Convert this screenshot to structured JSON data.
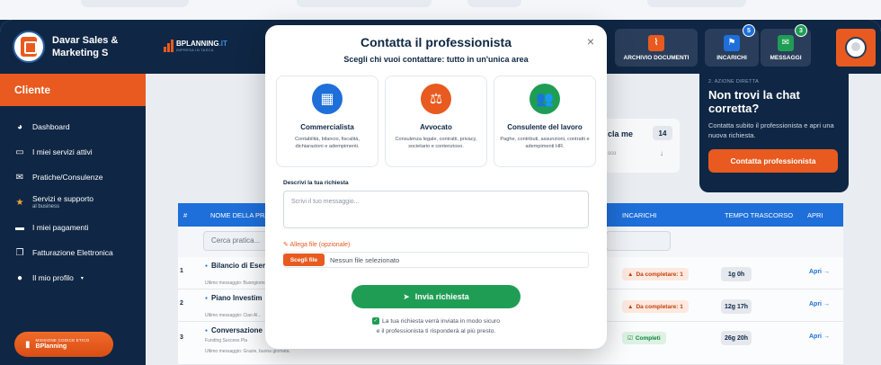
{
  "sidebar": {
    "brand_name": "Davar Sales & Marketing S",
    "cliente_label": "Cliente",
    "items": [
      {
        "label": "Dashboard",
        "sub": "",
        "icon": "dashboard-gauge-icon"
      },
      {
        "label": "I miei servizi attivi",
        "sub": "",
        "icon": "inbox-icon"
      },
      {
        "label": "Pratiche/Consulenze",
        "sub": "",
        "icon": "envelope-icon"
      },
      {
        "label": "Servizi e supporto",
        "sub": "al business",
        "icon": "star-icon"
      },
      {
        "label": "I miei pagamenti",
        "sub": "",
        "icon": "credit-card-icon"
      },
      {
        "label": "Fatturazione Elettronica",
        "sub": "",
        "icon": "copy-icon"
      },
      {
        "label": "Il mio profilo",
        "sub": "",
        "icon": "user-icon"
      }
    ],
    "codice_top": "MISSIONE CODICE ETICO",
    "codice_bottom": "BPlanning"
  },
  "header": {
    "logo_text_a": "BPLANNING",
    "logo_text_b": ".IT",
    "logo_tagline": "IMPRESA IN TASCA",
    "buttons": [
      {
        "label": "ARCHIVIO DOCUMENTI",
        "icon": "paperclip-icon",
        "color": "#e85a1f",
        "badge": ""
      },
      {
        "label": "INCARICHI",
        "icon": "flag-icon",
        "color": "#1e6fd9",
        "badge": "5"
      },
      {
        "label": "MESSAGGI",
        "icon": "envelope-icon",
        "color": "#1f9d55",
        "badge": "3"
      }
    ]
  },
  "promo": {
    "step": "2. AZIONE DIRETTA",
    "title": "Non trovi la chat corretta?",
    "desc": "Contatta subito il professionista e apri una nuova richiesta.",
    "cta": "Contatta professionista"
  },
  "stat": {
    "label": "cla me",
    "count": "14",
    "sub": "sco"
  },
  "table": {
    "headers": [
      "#",
      "NOME DELLA PRA",
      "INCARICHI",
      "TEMPO TRASCORSO",
      "APRI"
    ],
    "search_placeholder": "Cerca pratica...",
    "rows": [
      {
        "n": "1",
        "title": "Bilancio di Eser",
        "meta": "",
        "msg": "Ultimo messaggio: Buongiorno, gradirei...",
        "status": "Da completare: 1",
        "status_type": "pending",
        "time": "1g 0h",
        "apri": "Apri →"
      },
      {
        "n": "2",
        "title": "Piano Investim",
        "meta": "",
        "msg": "Ultimo messaggio: Ciao Al...",
        "status": "Da completare: 1",
        "status_type": "pending",
        "time": "12g 17h",
        "apri": "Apri →"
      },
      {
        "n": "3",
        "title": "Conversazione",
        "meta": "Funding Success Pla",
        "msg": "Ultimo messaggio: Grazie, buona giornata.",
        "status": "Completi",
        "status_type": "done",
        "time": "26g 20h",
        "apri": "Apri →"
      }
    ]
  },
  "modal": {
    "title": "Contatta il professionista",
    "subtitle": "Scegli chi vuoi contattare:  tutto in un'unica area",
    "close": "×",
    "cards": [
      {
        "name": "Commercialista",
        "desc": "Contabilità, bilancio, fiscalità, dichiarazioni e adempimenti.",
        "color": "#1e6fd9",
        "icon": "calculator-icon"
      },
      {
        "name": "Avvocato",
        "desc": "Consulenza legale, contratti, privacy, societario e contenzioso.",
        "color": "#e85a1f",
        "icon": "gavel-icon"
      },
      {
        "name": "Consulente del lavoro",
        "desc": "Paghe, contributi, assunzioni, contratti e adempimenti HR.",
        "color": "#1f9d55",
        "icon": "users-icon"
      }
    ],
    "describe_label": "Descrivi la tua richiesta",
    "textarea_placeholder": "Scrivi il tuo messaggio...",
    "attach_label": "Allega file (opzionale)",
    "file_button": "Scegli file",
    "file_none": "Nessun file selezionato",
    "send_label": "Invia richiesta",
    "note1": "La tua richiesta verrà inviata in modo sicuro",
    "note2": "e il professionista ti risponderà al più presto."
  }
}
